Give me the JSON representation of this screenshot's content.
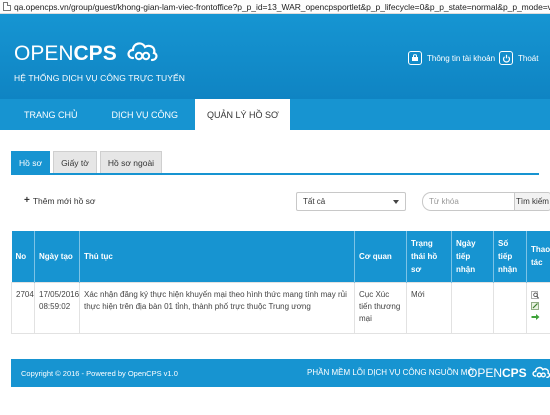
{
  "browser": {
    "url": "qa.opencps.vn/group/guest/khong-gian-lam-viec-frontoffice?p_p_id=13_WAR_opencpsportlet&p_p_lifecycle=0&p_p_state=normal&p_p_mode=view&p_p_col"
  },
  "header": {
    "logo_part1": "OPEN",
    "logo_part2": "CPS",
    "tagline": "HỆ THỐNG DỊCH VỤ CÔNG TRỰC TUYẾN",
    "account_label": "Thông tin tài khoản",
    "logout_label": "Thoát",
    "bg_color": "#1794d1"
  },
  "nav": {
    "items": [
      {
        "label": "TRANG CHỦ"
      },
      {
        "label": "DỊCH VỤ CÔNG"
      },
      {
        "label": "QUẢN LÝ HỒ SƠ"
      }
    ]
  },
  "tabs": [
    {
      "label": "Hồ sơ"
    },
    {
      "label": "Giấy tờ"
    },
    {
      "label": "Hồ sơ ngoài"
    }
  ],
  "toolbar": {
    "add_label": "Thêm mới hồ sơ",
    "status_selected": "Tất cả",
    "search_placeholder": "Từ khóa",
    "search_button": "Tìm kiếm"
  },
  "table": {
    "headers": [
      "No",
      "Ngày tạo",
      "Thủ tục",
      "Cơ quan",
      "Trạng thái hồ sơ",
      "Ngày tiếp nhận",
      "Số tiếp nhận",
      "Thao tác"
    ],
    "rows": [
      {
        "no": "2704",
        "date": "17/05/2016",
        "time": "08:59:02",
        "procedure": "Xác nhận đăng ký thực hiện khuyến mại theo hình thức mang tính may rủi thực hiện trên địa bàn 01 tỉnh, thành phố trực thuộc Trung ương",
        "agency": "Cục Xúc tiến thương mại",
        "status": "Mới",
        "received_date": "",
        "received_no": ""
      }
    ]
  },
  "footer": {
    "copyright": "Copyright © 2016 - Powered by OpenCPS v1.0",
    "slogan": "PHẦN MỀM LÕI DỊCH VỤ CÔNG NGUỒN MỞ",
    "logo_part1": "OPEN",
    "logo_part2": "CPS"
  },
  "icons": {
    "account": "account-icon",
    "logout": "power-icon",
    "view": "magnifier-icon",
    "edit": "edit-icon",
    "go": "arrow-right-icon"
  }
}
